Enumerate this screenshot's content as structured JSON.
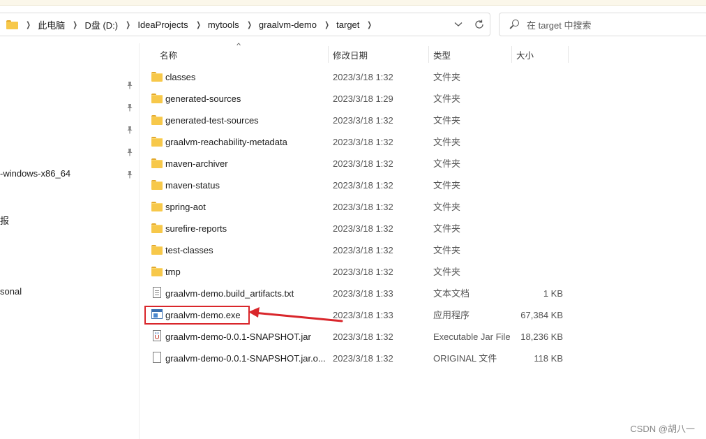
{
  "address_bar": {
    "crumbs": [
      "此电脑",
      "D盘 (D:)",
      "IdeaProjects",
      "mytools",
      "graalvm-demo",
      "target"
    ],
    "dropdown_icon": "chevron-down-icon",
    "refresh_icon": "refresh-icon"
  },
  "search": {
    "placeholder": "在 target 中搜索"
  },
  "nav": {
    "items": [
      "-windows-x86_64",
      "报",
      "sonal"
    ]
  },
  "columns": {
    "name": "名称",
    "date": "修改日期",
    "type": "类型",
    "size": "大小"
  },
  "files": [
    {
      "name": "classes",
      "date": "2023/3/18 1:32",
      "type": "文件夹",
      "size": "",
      "icon": "folder-icon"
    },
    {
      "name": "generated-sources",
      "date": "2023/3/18 1:29",
      "type": "文件夹",
      "size": "",
      "icon": "folder-icon"
    },
    {
      "name": "generated-test-sources",
      "date": "2023/3/18 1:32",
      "type": "文件夹",
      "size": "",
      "icon": "folder-icon"
    },
    {
      "name": "graalvm-reachability-metadata",
      "date": "2023/3/18 1:32",
      "type": "文件夹",
      "size": "",
      "icon": "folder-icon"
    },
    {
      "name": "maven-archiver",
      "date": "2023/3/18 1:32",
      "type": "文件夹",
      "size": "",
      "icon": "folder-icon"
    },
    {
      "name": "maven-status",
      "date": "2023/3/18 1:32",
      "type": "文件夹",
      "size": "",
      "icon": "folder-icon"
    },
    {
      "name": "spring-aot",
      "date": "2023/3/18 1:32",
      "type": "文件夹",
      "size": "",
      "icon": "folder-icon"
    },
    {
      "name": "surefire-reports",
      "date": "2023/3/18 1:32",
      "type": "文件夹",
      "size": "",
      "icon": "folder-icon"
    },
    {
      "name": "test-classes",
      "date": "2023/3/18 1:32",
      "type": "文件夹",
      "size": "",
      "icon": "folder-icon"
    },
    {
      "name": "tmp",
      "date": "2023/3/18 1:32",
      "type": "文件夹",
      "size": "",
      "icon": "folder-icon"
    },
    {
      "name": "graalvm-demo.build_artifacts.txt",
      "date": "2023/3/18 1:33",
      "type": "文本文档",
      "size": "1 KB",
      "icon": "text-file-icon"
    },
    {
      "name": "graalvm-demo.exe",
      "date": "2023/3/18 1:33",
      "type": "应用程序",
      "size": "67,384 KB",
      "icon": "exe-file-icon"
    },
    {
      "name": "graalvm-demo-0.0.1-SNAPSHOT.jar",
      "date": "2023/3/18 1:32",
      "type": "Executable Jar File",
      "size": "18,236 KB",
      "icon": "jar-file-icon"
    },
    {
      "name": "graalvm-demo-0.0.1-SNAPSHOT.jar.o...",
      "date": "2023/3/18 1:32",
      "type": "ORIGINAL 文件",
      "size": "118 KB",
      "icon": "file-icon"
    }
  ],
  "annotation": {
    "highlighted_file": "graalvm-demo.exe",
    "color": "#d9262b"
  },
  "watermark": "CSDN @胡八一"
}
